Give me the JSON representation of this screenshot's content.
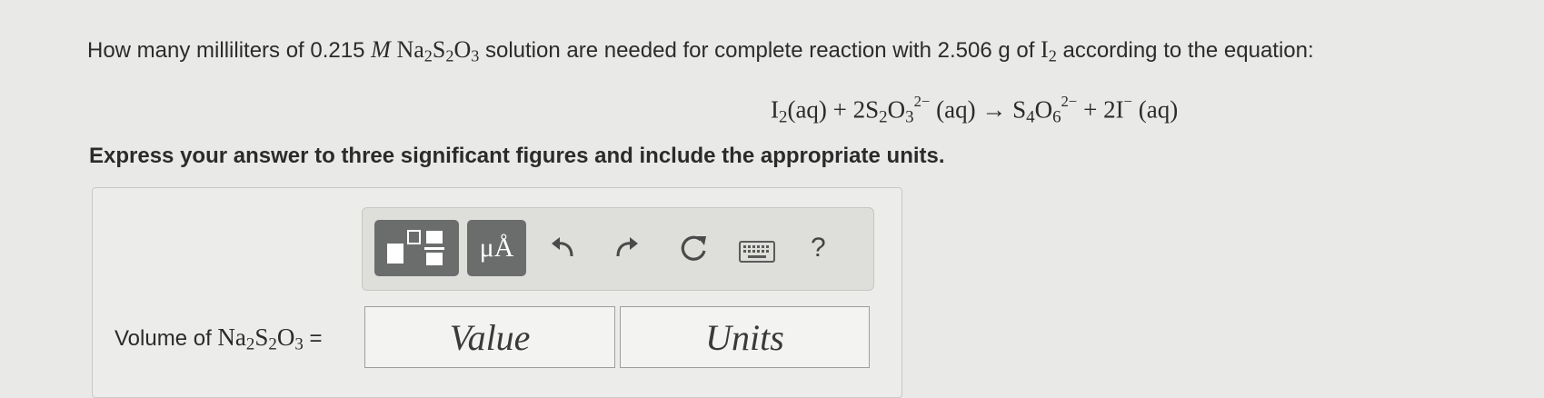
{
  "question": {
    "t1": "How many milliliters of 0.215 ",
    "unit_m": "M",
    "na": "Na",
    "s": "S",
    "o": "O",
    "n2": "2",
    "n2b": "2",
    "n3": "3",
    "t2": " solution are needed for complete reaction with 2.506 g of ",
    "i": "I",
    "i2": "2",
    "t3": " according to the equation:"
  },
  "equation": {
    "i": "I",
    "i_sub": "2",
    "aq1": "(aq) + 2S",
    "s_sub": "2",
    "o": "O",
    "o_sub": "3",
    "charge1": "2−",
    "aq2": " (aq) → S",
    "s2_sub": "4",
    "o2": "O",
    "o2_sub": "6",
    "charge2": "2−",
    "plus": " + 2I",
    "charge3": "−",
    "aq3": " (aq)"
  },
  "instruction": "Express your answer to three significant figures and include the appropriate units.",
  "toolbar": {
    "units_button_label": "μÅ",
    "help_label": "?"
  },
  "answer": {
    "label_prefix": "Volume of ",
    "na": "Na",
    "n2": "2",
    "s": "S",
    "n2b": "2",
    "o": "O",
    "n3": "3",
    "eq": " =",
    "value_placeholder": "Value",
    "units_placeholder": "Units"
  },
  "colors": {
    "toolbar_button": "#6b6c6c",
    "panel_bg": "#ececea"
  }
}
